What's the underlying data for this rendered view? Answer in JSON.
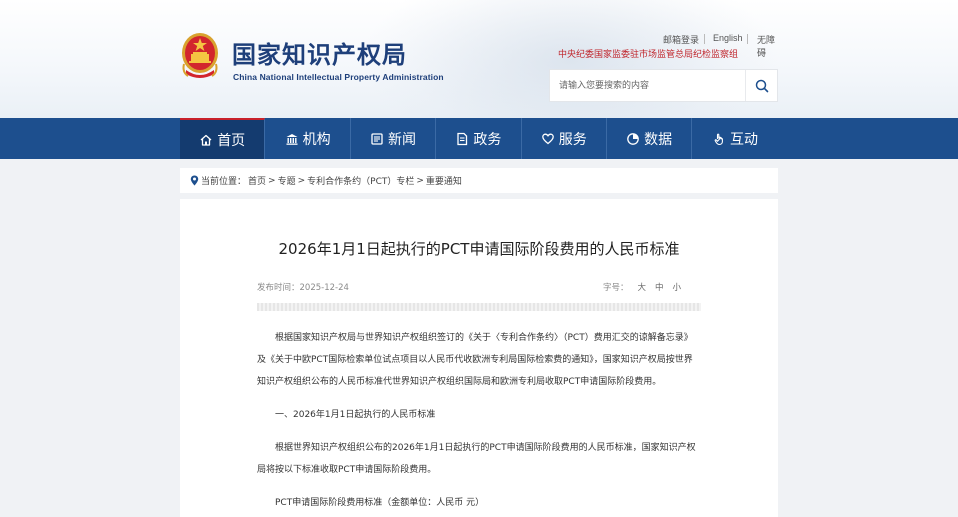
{
  "header": {
    "logo_cn": "国家知识产权局",
    "logo_en": "China National Intellectual Property Administration",
    "top_links": [
      "邮箱登录",
      "English",
      "无障碍"
    ],
    "supervise_link": "中央纪委国家监委驻市场监管总局纪检监察组",
    "search": {
      "placeholder": "请输入您要搜索的内容"
    }
  },
  "nav": {
    "items": [
      {
        "label": "首页",
        "icon": "home-icon"
      },
      {
        "label": "机构",
        "icon": "institution-icon"
      },
      {
        "label": "新闻",
        "icon": "news-icon"
      },
      {
        "label": "政务",
        "icon": "document-icon"
      },
      {
        "label": "服务",
        "icon": "heart-hand-icon"
      },
      {
        "label": "数据",
        "icon": "pie-chart-icon"
      },
      {
        "label": "互动",
        "icon": "hand-pointer-icon"
      }
    ],
    "active_index": 0
  },
  "breadcrumb": {
    "prefix": "当前位置：",
    "crumbs": [
      "首页",
      "专题",
      "专利合作条约（PCT）专栏",
      "重要通知"
    ],
    "separator": ">"
  },
  "article": {
    "title": "2026年1月1日起执行的PCT申请国际阶段费用的人民币标准",
    "date_label": "发布时间：2025-12-24",
    "font_size_label": "字号：",
    "font_sizes": [
      "大",
      "中",
      "小"
    ],
    "paragraphs": [
      "根据国家知识产权局与世界知识产权组织签订的《关于〈专利合作条约〉（PCT）费用汇交的谅解备忘录》及《关于中欧PCT国际检索单位试点项目以人民币代收欧洲专利局国际检索费的通知》，国家知识产权局按世界知识产权组织公布的人民币标准代世界知识产权组织国际局和欧洲专利局收取PCT申请国际阶段费用。",
      "一、2026年1月1日起执行的人民币标准",
      "根据世界知识产权组织公布的2026年1月1日起执行的PCT申请国际阶段费用的人民币标准，国家知识产权局将按以下标准收取PCT申请国际阶段费用。",
      "PCT申请国际阶段费用标准（金额单位：人民币 元）"
    ]
  },
  "colors": {
    "nav_bg": "#1d4f8e",
    "nav_active": "#143b6f",
    "brand_blue": "#1e3f7a",
    "supervise_red": "#c0262d"
  }
}
